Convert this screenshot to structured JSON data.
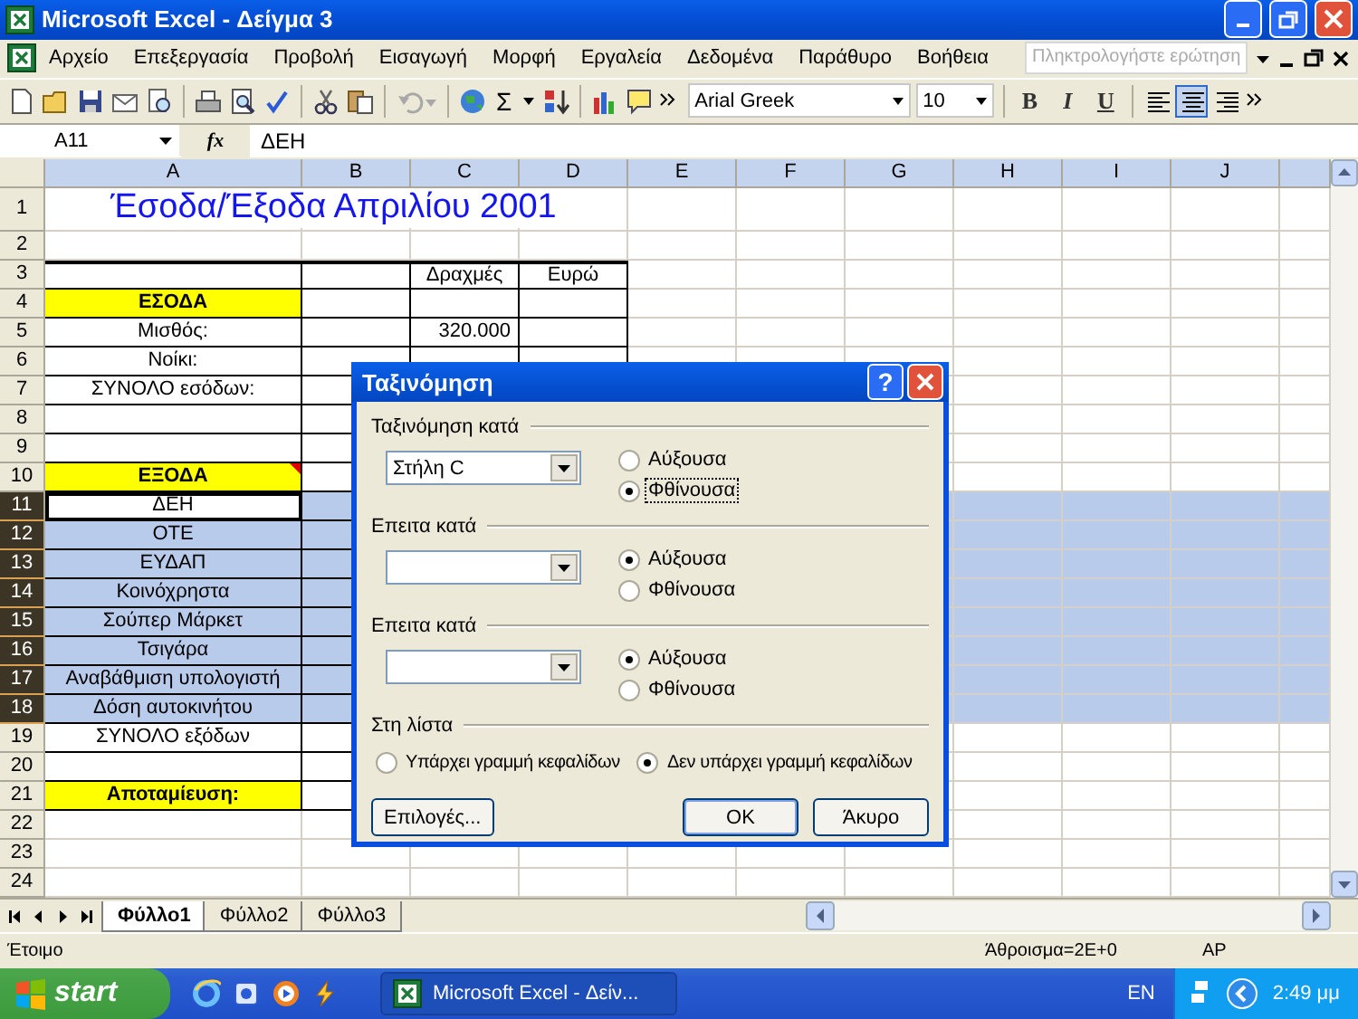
{
  "window": {
    "title": "Microsoft Excel - Δείγμα 3"
  },
  "menu": {
    "items": [
      "Αρχείο",
      "Επεξεργασία",
      "Προβολή",
      "Εισαγωγή",
      "Μορφή",
      "Εργαλεία",
      "Δεδομένα",
      "Παράθυρο",
      "Βοήθεια"
    ],
    "help_box": {
      "placeholder": "Πληκτρολογήστε ερώτηση"
    }
  },
  "toolbar": {
    "undo_disabled": true,
    "sum_symbol": "Σ",
    "font": "Arial Greek",
    "size": "10",
    "format_buttons": [
      {
        "label": "B",
        "selected": false
      },
      {
        "label": "I",
        "selected": false
      },
      {
        "label": "U",
        "selected": false
      }
    ],
    "alignment": [
      {
        "kind": "left",
        "selected": false
      },
      {
        "kind": "center",
        "selected": true
      },
      {
        "kind": "right",
        "selected": false
      }
    ]
  },
  "formula_bar": {
    "name_box": "A11",
    "function_label": "fx",
    "content": "ΔΕΗ"
  },
  "sheet": {
    "columns": [
      {
        "label": "A",
        "highlighted": true
      },
      {
        "label": "B",
        "highlighted": true
      },
      {
        "label": "C",
        "highlighted": true
      },
      {
        "label": "D",
        "highlighted": true
      },
      {
        "label": "E",
        "highlighted": true
      },
      {
        "label": "F",
        "highlighted": true
      },
      {
        "label": "G",
        "highlighted": true
      },
      {
        "label": "H",
        "highlighted": true
      },
      {
        "label": "I",
        "highlighted": true
      },
      {
        "label": "J",
        "highlighted": true
      }
    ],
    "rows": [
      {
        "number": "1",
        "selected": false,
        "cells": {
          "A": {
            "text": "Έσοδα/Έξοδα Απριλίου 2001",
            "kind": "title"
          }
        }
      },
      {
        "number": "2",
        "selected": false
      },
      {
        "number": "3",
        "selected": false,
        "cells": {
          "C": {
            "text": "Δραχμές",
            "kind": "label"
          },
          "D": {
            "text": "Ευρώ",
            "kind": "label"
          }
        }
      },
      {
        "number": "4",
        "selected": false,
        "cells": {
          "A": {
            "text": "ΕΣΟΔΑ",
            "kind": "heading"
          }
        }
      },
      {
        "number": "5",
        "selected": false,
        "cells": {
          "A": {
            "text": "Μισθός:",
            "kind": "label"
          },
          "C": {
            "text": "320.000",
            "kind": "number"
          }
        }
      },
      {
        "number": "6",
        "selected": false,
        "cells": {
          "A": {
            "text": "Νοίκι:",
            "kind": "label"
          }
        }
      },
      {
        "number": "7",
        "selected": false,
        "cells": {
          "A": {
            "text": "ΣΥΝΟΛΟ εσόδων:",
            "kind": "label"
          }
        }
      },
      {
        "number": "8",
        "selected": false
      },
      {
        "number": "9",
        "selected": false
      },
      {
        "number": "10",
        "selected": false,
        "cells": {
          "A": {
            "text": "ΕΞΟΔΑ",
            "kind": "heading",
            "comment": true
          }
        }
      },
      {
        "number": "11",
        "selected": true,
        "cells": {
          "A": {
            "text": "ΔΕΗ",
            "kind": "label",
            "active": true
          }
        }
      },
      {
        "number": "12",
        "selected": true,
        "cells": {
          "A": {
            "text": "ΟΤΕ",
            "kind": "label"
          }
        }
      },
      {
        "number": "13",
        "selected": true,
        "cells": {
          "A": {
            "text": "ΕΥΔΑΠ",
            "kind": "label"
          }
        }
      },
      {
        "number": "14",
        "selected": true,
        "cells": {
          "A": {
            "text": "Κοινόχρηστα",
            "kind": "label"
          }
        }
      },
      {
        "number": "15",
        "selected": true,
        "cells": {
          "A": {
            "text": "Σούπερ Μάρκετ",
            "kind": "label"
          }
        }
      },
      {
        "number": "16",
        "selected": true,
        "cells": {
          "A": {
            "text": "Τσιγάρα",
            "kind": "label"
          }
        }
      },
      {
        "number": "17",
        "selected": true,
        "cells": {
          "A": {
            "text": "Αναβάθμιση υπολογιστή",
            "kind": "label"
          }
        }
      },
      {
        "number": "18",
        "selected": true,
        "cells": {
          "A": {
            "text": "Δόση αυτοκινήτου",
            "kind": "label"
          }
        }
      },
      {
        "number": "19",
        "selected": false,
        "cells": {
          "A": {
            "text": "ΣΥΝΟΛΟ εξόδων",
            "kind": "label"
          }
        }
      },
      {
        "number": "20",
        "selected": false
      },
      {
        "number": "21",
        "selected": false,
        "cells": {
          "A": {
            "text": "Αποταμίευση:",
            "kind": "heading"
          }
        }
      },
      {
        "number": "22",
        "selected": false
      },
      {
        "number": "23",
        "selected": false
      },
      {
        "number": "24",
        "selected": false
      }
    ]
  },
  "sheet_tabs": [
    {
      "label": "Φύλλο1",
      "selected": true
    },
    {
      "label": "Φύλλο2",
      "selected": false
    },
    {
      "label": "Φύλλο3",
      "selected": false
    }
  ],
  "status_bar": {
    "message": "Έτοιμο",
    "sum": "Άθροισμα=2E+0",
    "indicator": "ΑΡ"
  },
  "dialog": {
    "title": "Ταξινόμηση",
    "help_label": "?",
    "groups": [
      {
        "label": "Ταξινόμηση κατά",
        "kind": "dropdown",
        "value": "Στήλη C",
        "options": [
          {
            "label": "Αύξουσα",
            "selected": false,
            "focused": false
          },
          {
            "label": "Φθίνουσα",
            "selected": true,
            "focused": true
          }
        ]
      },
      {
        "label": "Επειτα κατά",
        "kind": "dropdown",
        "options": [
          {
            "label": "Αύξουσα",
            "selected": true,
            "focused": false
          },
          {
            "label": "Φθίνουσα",
            "selected": false,
            "focused": false
          }
        ]
      },
      {
        "label": "Επειτα κατά",
        "kind": "dropdown",
        "options": [
          {
            "label": "Αύξουσα",
            "selected": true,
            "focused": false
          },
          {
            "label": "Φθίνουσα",
            "selected": false,
            "focused": false
          }
        ]
      },
      {
        "label": "Στη λίστα",
        "kind": "row",
        "options": [
          {
            "label": "Υπάρχει γραμμή κεφαλίδων",
            "selected": false,
            "focused": false
          },
          {
            "label": "Δεν υπάρχει γραμμή κεφαλίδων",
            "selected": true,
            "focused": false
          }
        ]
      }
    ],
    "buttons": [
      {
        "label": "Επιλογές...",
        "default": false
      },
      {
        "label": "OK",
        "default": true
      },
      {
        "label": "Άκυρο",
        "default": false
      }
    ]
  },
  "taskbar": {
    "start": "start",
    "tasks": [
      {
        "label": "Microsoft Excel - Δείν...",
        "selected": true
      }
    ],
    "language": "EN",
    "clock": "2:49 μμ"
  }
}
